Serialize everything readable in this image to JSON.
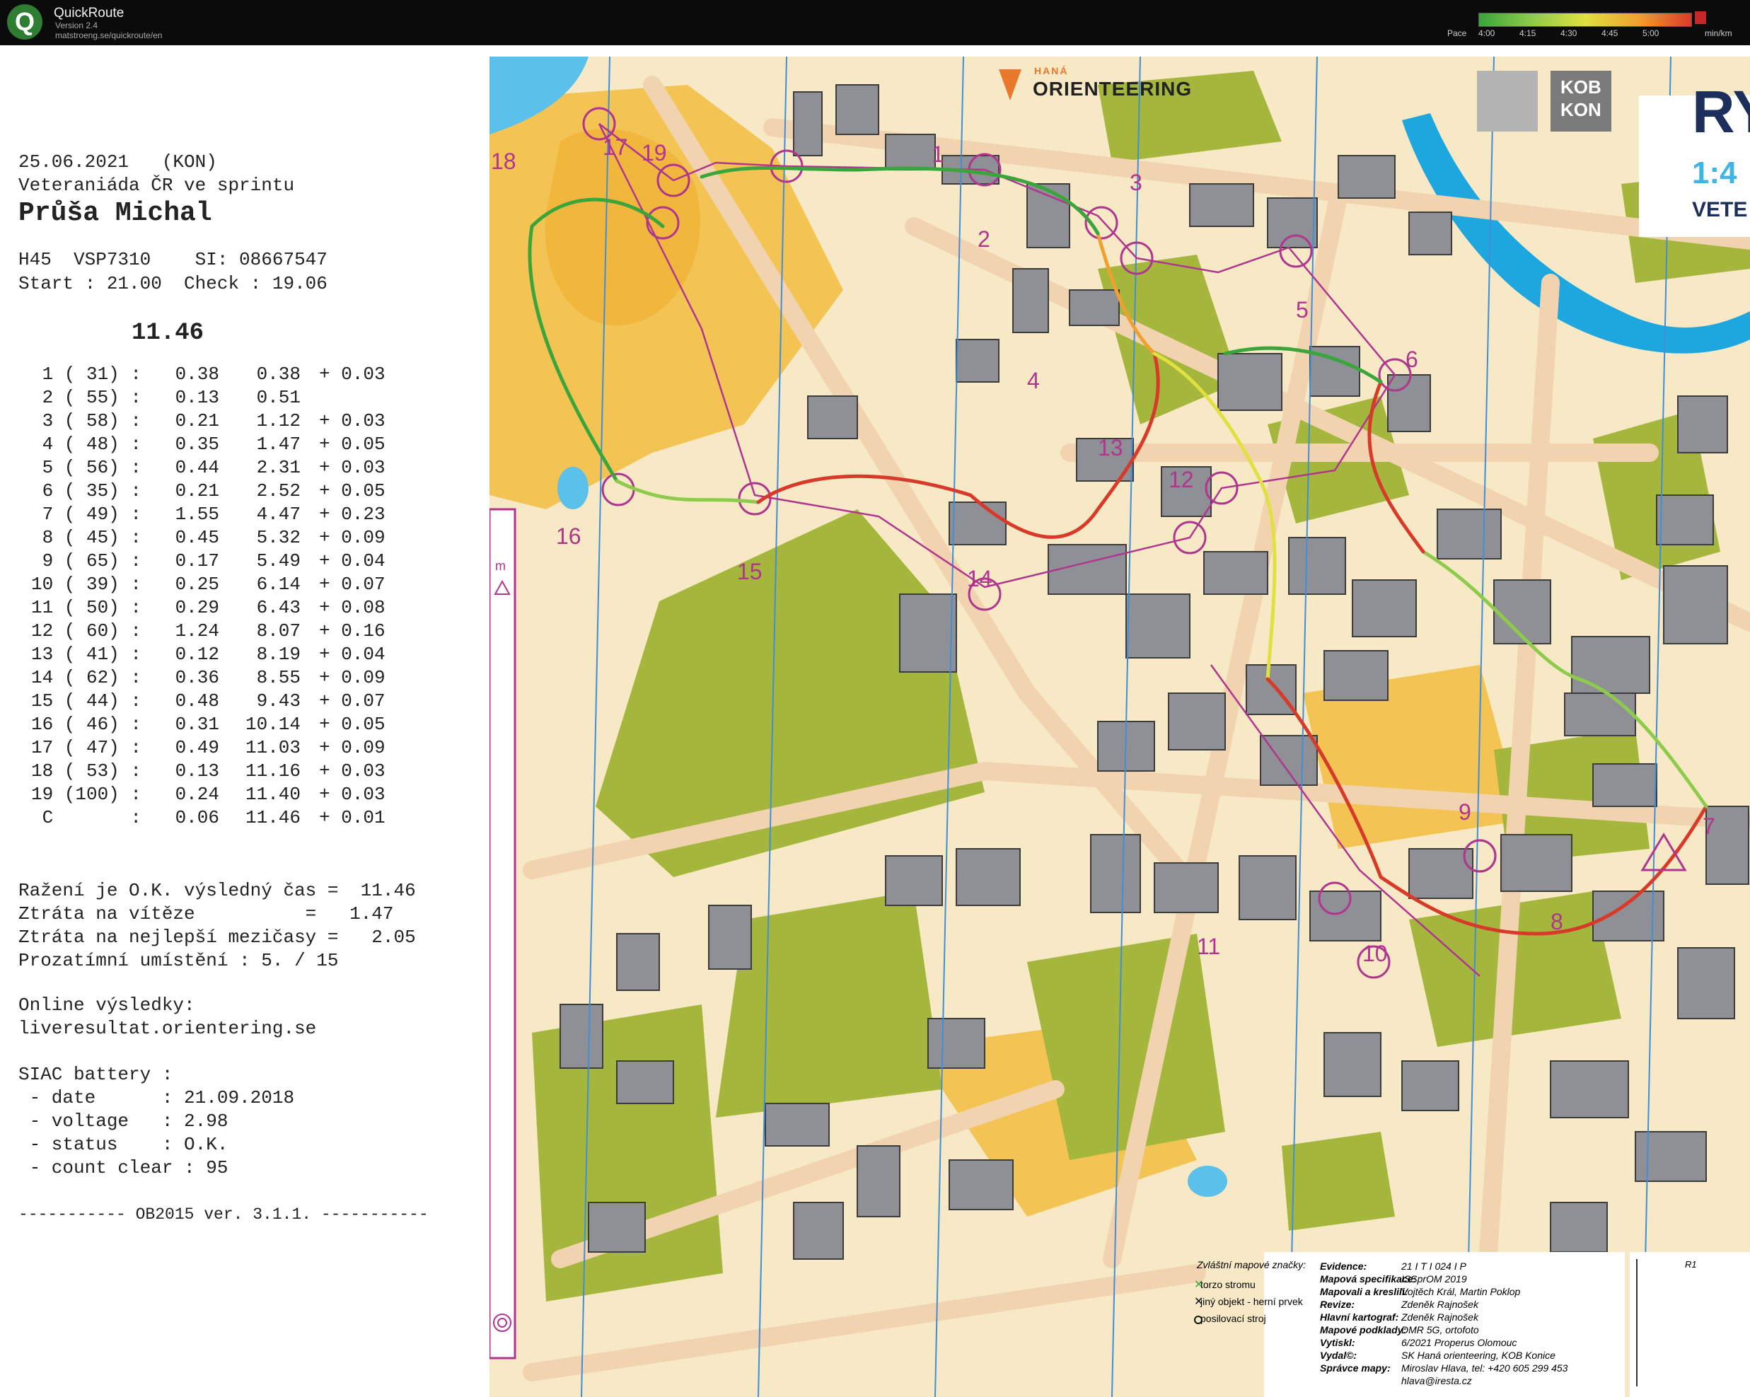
{
  "app": {
    "name": "QuickRoute",
    "version": "Version 2.4",
    "url": "matstroeng.se/quickroute/en",
    "pace_label": "Pace",
    "pace_ticks": [
      "4:00",
      "4:15",
      "4:30",
      "4:45",
      "5:00"
    ],
    "pace_unit": "min/km",
    "pace_colors": [
      "#3aa53a",
      "#8ecb4c",
      "#e0e040",
      "#f0a030",
      "#d83a2a"
    ]
  },
  "receipt": {
    "date_line": "25.06.2021   (KON)",
    "event": "Veteraniáda ČR ve sprintu",
    "name": "Průša Michal",
    "class_line": "H45  VSP7310    SI: 08667547",
    "start_line": "Start : 21.00  Check : 19.06",
    "total": "11.46",
    "splits": [
      {
        "num": "1 ( 31) :",
        "leg": "0.38",
        "cum": "0.38",
        "loss": "+ 0.03"
      },
      {
        "num": "2 ( 55) :",
        "leg": "0.13",
        "cum": "0.51",
        "loss": ""
      },
      {
        "num": "3 ( 58) :",
        "leg": "0.21",
        "cum": "1.12",
        "loss": "+ 0.03"
      },
      {
        "num": "4 ( 48) :",
        "leg": "0.35",
        "cum": "1.47",
        "loss": "+ 0.05"
      },
      {
        "num": "5 ( 56) :",
        "leg": "0.44",
        "cum": "2.31",
        "loss": "+ 0.03"
      },
      {
        "num": "6 ( 35) :",
        "leg": "0.21",
        "cum": "2.52",
        "loss": "+ 0.05"
      },
      {
        "num": "7 ( 49) :",
        "leg": "1.55",
        "cum": "4.47",
        "loss": "+ 0.23"
      },
      {
        "num": "8 ( 45) :",
        "leg": "0.45",
        "cum": "5.32",
        "loss": "+ 0.09"
      },
      {
        "num": "9 ( 65) :",
        "leg": "0.17",
        "cum": "5.49",
        "loss": "+ 0.04"
      },
      {
        "num": "10 ( 39) :",
        "leg": "0.25",
        "cum": "6.14",
        "loss": "+ 0.07"
      },
      {
        "num": "11 ( 50) :",
        "leg": "0.29",
        "cum": "6.43",
        "loss": "+ 0.08"
      },
      {
        "num": "12 ( 60) :",
        "leg": "1.24",
        "cum": "8.07",
        "loss": "+ 0.16"
      },
      {
        "num": "13 ( 41) :",
        "leg": "0.12",
        "cum": "8.19",
        "loss": "+ 0.04"
      },
      {
        "num": "14 ( 62) :",
        "leg": "0.36",
        "cum": "8.55",
        "loss": "+ 0.09"
      },
      {
        "num": "15 ( 44) :",
        "leg": "0.48",
        "cum": "9.43",
        "loss": "+ 0.07"
      },
      {
        "num": "16 ( 46) :",
        "leg": "0.31",
        "cum": "10.14",
        "loss": "+ 0.05"
      },
      {
        "num": "17 ( 47) :",
        "leg": "0.49",
        "cum": "11.03",
        "loss": "+ 0.09"
      },
      {
        "num": "18 ( 53) :",
        "leg": "0.13",
        "cum": "11.16",
        "loss": "+ 0.03"
      },
      {
        "num": "19 (100) :",
        "leg": "0.24",
        "cum": "11.40",
        "loss": "+ 0.03"
      },
      {
        "num": " C       :",
        "leg": "0.06",
        "cum": "11.46",
        "loss": "+ 0.01"
      }
    ],
    "result_lines": [
      "Ražení je O.K. výsledný čas =  11.46",
      "Ztráta na vítěze          =   1.47",
      "Ztráta na nejlepší mezičasy =   2.05",
      "Prozatímní umístění : 5. / 15"
    ],
    "online_label": "Online výsledky:",
    "online_url": "liveresultat.orientering.se",
    "battery_label": "SIAC battery :",
    "battery_lines": [
      " - date      : 21.09.2018",
      " - voltage   : 2.98",
      " - status    : O.K.",
      " - count clear : 95"
    ],
    "footer": "----------- OB2015 ver. 3.1.1. -----------"
  },
  "map": {
    "brand_small": "HANÁ",
    "brand": "ORIENTEERING",
    "kob_line1": "KOB",
    "kob_line2": "KON",
    "title_fragment": "RY",
    "scale_fragment": "1:4",
    "event_fragment": "VETE",
    "scale_bar_unit": "m",
    "r1": "R1",
    "control_numbers": [
      "1",
      "2",
      "3",
      "4",
      "5",
      "6",
      "7",
      "8",
      "9",
      "10",
      "11",
      "12",
      "13",
      "14",
      "15",
      "16",
      "17",
      "18",
      "19"
    ],
    "legend": {
      "title": "Zvláštní mapové značky:",
      "items": [
        "torzo stromu",
        "jiný objekt - herní prvek",
        "posilovací stroj"
      ]
    },
    "imprint": [
      {
        "k": "Evidence:",
        "v": "21 I T I 024 I P"
      },
      {
        "k": "Mapová specifikace:",
        "v": "ISSprOM 2019"
      },
      {
        "k": "Mapovali a kreslili:",
        "v": "Vojtěch Král, Martin Poklop"
      },
      {
        "k": "Revize:",
        "v": "Zdeněk Rajnošek"
      },
      {
        "k": "Hlavní kartograf:",
        "v": "Zdeněk Rajnošek"
      },
      {
        "k": "Mapové podklady:",
        "v": "DMR 5G, ortofoto"
      },
      {
        "k": "Vytiskl:",
        "v": "6/2021 Properus Olomouc"
      },
      {
        "k": "Vydal©:",
        "v": "SK Haná orienteering, KOB Konice"
      },
      {
        "k": "Správce mapy:",
        "v": "Miroslav Hlava, tel: +420 605 299 453"
      },
      {
        "k": "",
        "v": "hlava@iresta.cz"
      }
    ]
  }
}
